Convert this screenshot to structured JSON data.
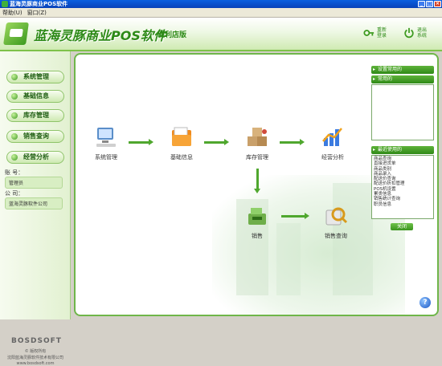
{
  "window": {
    "title": "蓝海灵豚商业POS软件"
  },
  "menu": {
    "items": [
      "帮助(U)",
      "窗口(Z)"
    ]
  },
  "banner": {
    "brand": "蓝海灵豚商业POS软件",
    "edition": "便利店版",
    "relogin": "重新登录",
    "exit": "退出系统"
  },
  "sidebar": {
    "nav": [
      "系统管理",
      "基础信息",
      "库存管理",
      "销售查询",
      "经营分析"
    ],
    "account_label": "账  号：",
    "account_value": "管理员",
    "company_label": "公  司：",
    "company_value": "蓝海灵豚软件公司",
    "footer_logo": "BOSDSOFT",
    "copyright": "© 版权所有",
    "company_full": "沈阳蓝海灵豚软件技术有限公司",
    "website": "www.bosdsoft.com"
  },
  "flow": {
    "system": "系统管理",
    "basic": "基础信息",
    "stock": "库存管理",
    "analysis": "经营分析",
    "sales": "销售",
    "sales_query": "销售查询"
  },
  "right_panel": {
    "header1": "设置常用的",
    "header2": "常用的",
    "header3": "最近使用的",
    "recent": [
      "商品查询",
      "直接进货单",
      "商品类别",
      "商品录入",
      "配送价查询",
      "配送价折扣管理",
      "POS机设置",
      "累类信息",
      "销售统计查询",
      "职员信息"
    ],
    "close": "关闭"
  },
  "colors": {
    "accent": "#4fa72e",
    "brand": "#2d8a17"
  }
}
